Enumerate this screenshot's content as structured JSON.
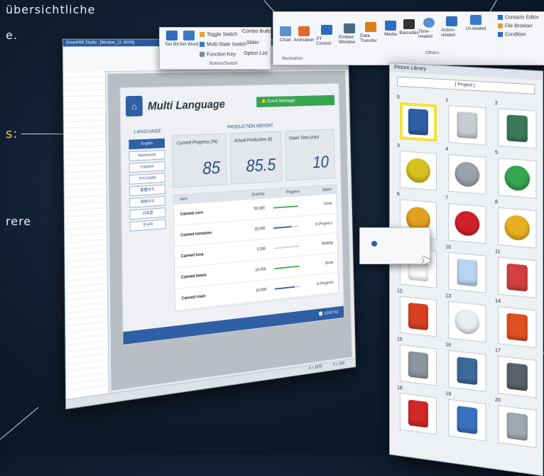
{
  "background_text": {
    "line1": "übersichtliche",
    "line2": "e.",
    "line3": "s:",
    "line4": "rere"
  },
  "ribbon_left": {
    "set_bit": "Set Bit",
    "set_word": "Set Word",
    "toggle_switch": "Toggle Switch",
    "multi_state_switch": "Multi-State Switch",
    "function_key": "Function Key",
    "combo_button": "Combo Button",
    "slider": "Slider",
    "option_list": "Option List",
    "group_caption": "Button/Switch"
  },
  "ribbon_right": {
    "chart": "Chart",
    "animation": "Animation",
    "illustration_caption": "Illustration",
    "xy_control": "XY Control",
    "embed_window": "Embed Window",
    "data_transfer": "Data Transfer",
    "media": "Media",
    "barcodes": "Barcodes",
    "time_related": "Time-related",
    "action_related": "Action-related",
    "ui_related": "UI-related",
    "others_caption": "Others",
    "contacts_editor": "Contacts Editor",
    "file_browser": "File Browser",
    "condition": "Condition"
  },
  "window": {
    "title": "SmartHMI Studio - [Window_11: MAIN]",
    "status_x": "X = 1073",
    "status_y": "Y = 203"
  },
  "hmi": {
    "title": "Multi Language",
    "event_message": "Event Message",
    "language_label": "LANGUAGE",
    "languages": [
      "English",
      "Nederlands",
      "Español",
      "РУССКИЙ",
      "繁體中文",
      "简体中文",
      "日本語",
      "한국어"
    ],
    "production_title": "PRODUCTION REPORT",
    "cards": [
      {
        "label": "Current Progress (%)",
        "value": "85"
      },
      {
        "label": "Actual Production (k)",
        "value": "85.5"
      },
      {
        "label": "Down Time (min)",
        "value": "10"
      }
    ],
    "table_headers": [
      "Item",
      "Quantity",
      "Progress",
      "Status"
    ],
    "rows": [
      {
        "item": "Canned corn",
        "qty": "50,000",
        "progress": 1.0,
        "color": "#3fae4a",
        "status": "Done"
      },
      {
        "item": "Canned tomatoes",
        "qty": "20,000",
        "progress": 0.7,
        "color": "#2f5fa4",
        "status": "In Progress"
      },
      {
        "item": "Canned tuna",
        "qty": "5,000",
        "progress": 0.0,
        "color": "#cfd4da",
        "status": "Waiting"
      },
      {
        "item": "Canned beans",
        "qty": "10,000",
        "progress": 1.0,
        "color": "#3fae4a",
        "status": "Done"
      },
      {
        "item": "Canned roast",
        "qty": "15,000",
        "progress": 0.8,
        "color": "#2f5fa4",
        "status": "In Progress"
      }
    ],
    "clock": "10:57:02"
  },
  "library": {
    "title": "Picture Library",
    "project": "[ Project ]",
    "items": [
      {
        "num": "0",
        "icon": "blue-switch",
        "color": "#2f5fa4"
      },
      {
        "num": "1",
        "icon": "toggle-switch",
        "color": "#c9ccd1"
      },
      {
        "num": "2",
        "icon": "panel-switch",
        "color": "#3a7a5a"
      },
      {
        "num": "3",
        "icon": "yellow-button",
        "color": "#d6c21e"
      },
      {
        "num": "4",
        "icon": "silver-button",
        "color": "#9aa2ab"
      },
      {
        "num": "5",
        "icon": "green-button",
        "color": "#35a550"
      },
      {
        "num": "6",
        "icon": "emergency-stop-small",
        "color": "#e0a020"
      },
      {
        "num": "7",
        "icon": "emergency-stop-red",
        "color": "#d0202a"
      },
      {
        "num": "8",
        "icon": "emergency-stop-box",
        "color": "#e8b020"
      },
      {
        "num": "9",
        "icon": "blank",
        "color": "#ffffff"
      },
      {
        "num": "10",
        "icon": "label-plate",
        "color": "#b9d4f0"
      },
      {
        "num": "11",
        "icon": "bell",
        "color": "#d04040"
      },
      {
        "num": "12",
        "icon": "stop-panel",
        "color": "#d84020"
      },
      {
        "num": "13",
        "icon": "gauge",
        "color": "#e8eef3"
      },
      {
        "num": "14",
        "icon": "beacon",
        "color": "#e05020"
      },
      {
        "num": "15",
        "icon": "pump",
        "color": "#8c96a0"
      },
      {
        "num": "16",
        "icon": "valve",
        "color": "#3c6a9a"
      },
      {
        "num": "17",
        "icon": "meter",
        "color": "#5a6068"
      },
      {
        "num": "18",
        "icon": "pipe-red",
        "color": "#d02828"
      },
      {
        "num": "19",
        "icon": "pipe-cross",
        "color": "#3a72c0"
      },
      {
        "num": "20",
        "icon": "pipe-tee",
        "color": "#a0a8b0"
      }
    ]
  }
}
